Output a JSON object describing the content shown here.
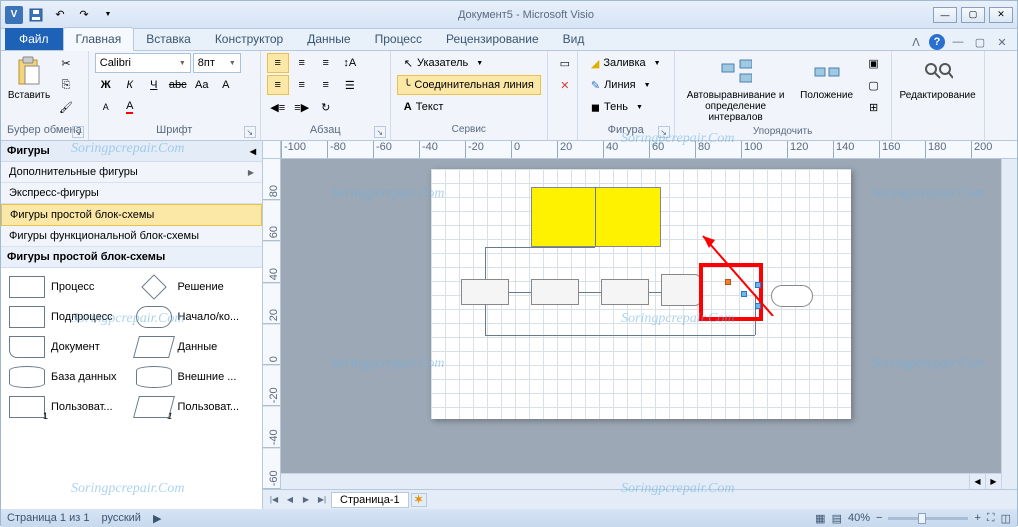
{
  "title": "Документ5 - Microsoft Visio",
  "visio_letter": "V",
  "tabs": {
    "file": "Файл",
    "home": "Главная",
    "insert": "Вставка",
    "design": "Конструктор",
    "data": "Данные",
    "process": "Процесс",
    "review": "Рецензирование",
    "view": "Вид"
  },
  "groups": {
    "clipboard": {
      "label": "Буфер обмена",
      "paste": "Вставить"
    },
    "font": {
      "label": "Шрифт",
      "name": "Calibri",
      "size": "8пт"
    },
    "paragraph": {
      "label": "Абзац"
    },
    "tools": {
      "label": "Сервис",
      "pointer": "Указатель",
      "connector": "Соединительная линия",
      "text": "Текст"
    },
    "shape": {
      "label": "Фигура",
      "fill": "Заливка",
      "line": "Линия",
      "shadow": "Тень"
    },
    "arrange": {
      "label": "Упорядочить",
      "auto": "Автовыравнивание и определение интервалов",
      "position": "Положение"
    },
    "editing": {
      "label": "Редактирование"
    }
  },
  "shapes_pane": {
    "title": "Фигуры",
    "more": "Дополнительные фигуры",
    "quick": "Экспресс-фигуры",
    "basic": "Фигуры простой блок-схемы",
    "func": "Фигуры функциональной блок-схемы",
    "section": "Фигуры простой блок-схемы",
    "items": {
      "process": "Процесс",
      "decision": "Решение",
      "subprocess": "Подпроцесс",
      "startend": "Начало/ко...",
      "document": "Документ",
      "data": "Данные",
      "database": "База данных",
      "external": "Внешние ...",
      "custom1": "Пользоват...",
      "custom2": "Пользоват..."
    }
  },
  "ruler_h": [
    "-100",
    "-80",
    "-60",
    "-40",
    "-20",
    "0",
    "20",
    "40",
    "60",
    "80",
    "100",
    "120",
    "140",
    "160",
    "180",
    "200"
  ],
  "ruler_v": [
    "80",
    "60",
    "40",
    "20",
    "0",
    "-20",
    "-40",
    "-60"
  ],
  "page_tab": "Страница-1",
  "status": {
    "page": "Страница 1 из 1",
    "lang": "русский",
    "zoom": "40%"
  },
  "watermark": "Soringpcrepair.Com"
}
